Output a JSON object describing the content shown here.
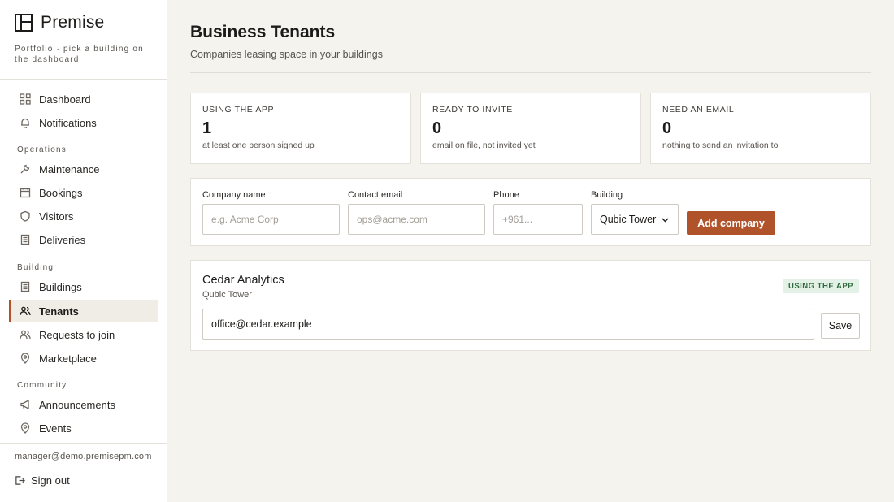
{
  "brand": {
    "name": "Premise",
    "subtitle": "Portfolio · pick a building on the dashboard"
  },
  "sidebar": {
    "top_items": [
      {
        "label": "Dashboard",
        "icon": "grid-icon"
      },
      {
        "label": "Notifications",
        "icon": "bell-icon"
      }
    ],
    "sections": [
      {
        "title": "Operations",
        "items": [
          {
            "label": "Maintenance",
            "icon": "wrench-icon"
          },
          {
            "label": "Bookings",
            "icon": "calendar-icon"
          },
          {
            "label": "Visitors",
            "icon": "shield-icon"
          },
          {
            "label": "Deliveries",
            "icon": "clipboard-icon"
          }
        ]
      },
      {
        "title": "Building",
        "items": [
          {
            "label": "Buildings",
            "icon": "building-icon"
          },
          {
            "label": "Tenants",
            "icon": "users-icon",
            "active": true
          },
          {
            "label": "Requests to join",
            "icon": "user-plus-icon"
          },
          {
            "label": "Marketplace",
            "icon": "map-pin-icon"
          }
        ]
      },
      {
        "title": "Community",
        "items": [
          {
            "label": "Announcements",
            "icon": "megaphone-icon"
          },
          {
            "label": "Events",
            "icon": "map-pin-icon"
          }
        ]
      }
    ],
    "user_email": "manager@demo.premisepm.com",
    "sign_out": "Sign out"
  },
  "page": {
    "title": "Business Tenants",
    "subtitle": "Companies leasing space in your buildings"
  },
  "stats": [
    {
      "label": "USING THE APP",
      "value": "1",
      "note": "at least one person signed up"
    },
    {
      "label": "READY TO INVITE",
      "value": "0",
      "note": "email on file, not invited yet"
    },
    {
      "label": "NEED AN EMAIL",
      "value": "0",
      "note": "nothing to send an invitation to"
    }
  ],
  "form": {
    "company_label": "Company name",
    "company_placeholder": "e.g. Acme Corp",
    "email_label": "Contact email",
    "email_placeholder": "ops@acme.com",
    "phone_label": "Phone",
    "phone_placeholder": "+961...",
    "building_label": "Building",
    "building_value": "Qubic Tower",
    "add_button": "Add company"
  },
  "tenants": [
    {
      "name": "Cedar Analytics",
      "building": "Qubic Tower",
      "status": "USING THE APP",
      "email": "office@cedar.example",
      "save": "Save"
    }
  ],
  "colors": {
    "accent": "#b0532b",
    "badge_bg": "#e3f1e6",
    "badge_text": "#2f6b3e",
    "page_bg": "#f5f3ee"
  }
}
